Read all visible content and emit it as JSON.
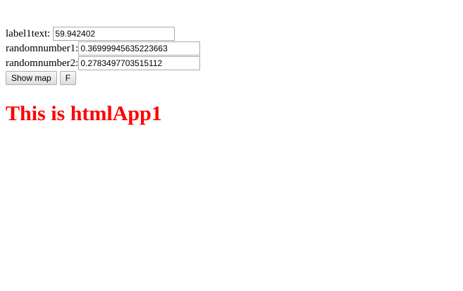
{
  "form": {
    "label1text": {
      "label": "label1text:",
      "value": "59.942402"
    },
    "randomnumber1": {
      "label": "randomnumber1:",
      "value": "0.36999945635223663"
    },
    "randomnumber2": {
      "label": "randomnumber2:",
      "value": "0.2783497703515112"
    }
  },
  "buttons": {
    "show_map": "Show map",
    "f": "F"
  },
  "heading": "This is htmlApp1",
  "colors": {
    "heading": "#ff0000"
  }
}
